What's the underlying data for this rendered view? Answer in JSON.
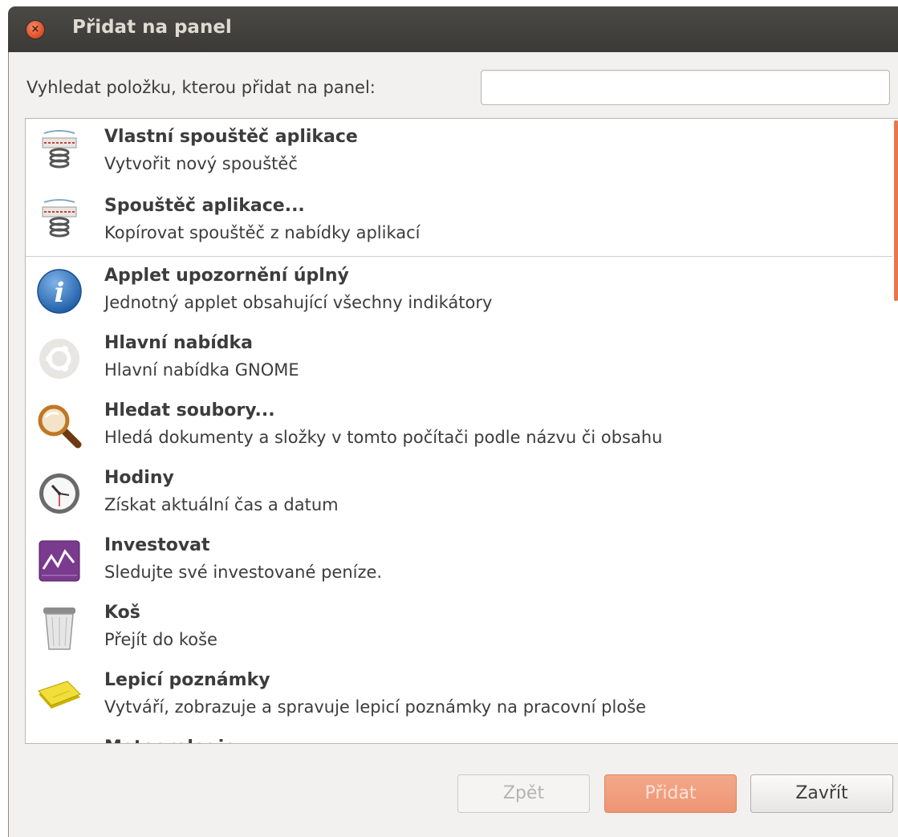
{
  "window": {
    "title": "Přidat na panel",
    "close_glyph": "×"
  },
  "search": {
    "label": "Vyhledat položku, kterou přidat na panel:",
    "value": "",
    "placeholder": ""
  },
  "items": [
    {
      "name": "Vlastní spouštěč aplikace",
      "desc": "Vytvořit nový spouštěč",
      "icon": "launcher-icon"
    },
    {
      "name": "Spouštěč aplikace...",
      "desc": "Kopírovat spouštěč z nabídky aplikací",
      "icon": "launcher-icon"
    },
    {
      "name": "Applet upozornění úplný",
      "desc": "Jednotný applet obsahující všechny indikátory",
      "icon": "info-icon"
    },
    {
      "name": "Hlavní nabídka",
      "desc": "Hlavní nabídka GNOME",
      "icon": "ubuntu-logo-icon"
    },
    {
      "name": "Hledat soubory...",
      "desc": "Hledá dokumenty a složky v tomto počítači podle názvu či obsahu",
      "icon": "magnifier-icon"
    },
    {
      "name": "Hodiny",
      "desc": "Získat aktuální čas a datum",
      "icon": "clock-icon"
    },
    {
      "name": "Investovat",
      "desc": "Sledujte své investované peníze.",
      "icon": "stock-chart-icon"
    },
    {
      "name": "Koš",
      "desc": "Přejít do koše",
      "icon": "trash-icon"
    },
    {
      "name": "Lepicí poznámky",
      "desc": "Vytváří, zobrazuje a spravuje lepicí poznámky na pracovní ploše",
      "icon": "sticky-notes-icon"
    },
    {
      "name": "Meteorologie",
      "desc": "",
      "icon": "partially-hidden"
    }
  ],
  "buttons": {
    "back": "Zpět",
    "add": "Přidat",
    "close": "Zavřít"
  },
  "colors": {
    "accent": "#e8774d",
    "titlebar": "#3c3b37"
  }
}
